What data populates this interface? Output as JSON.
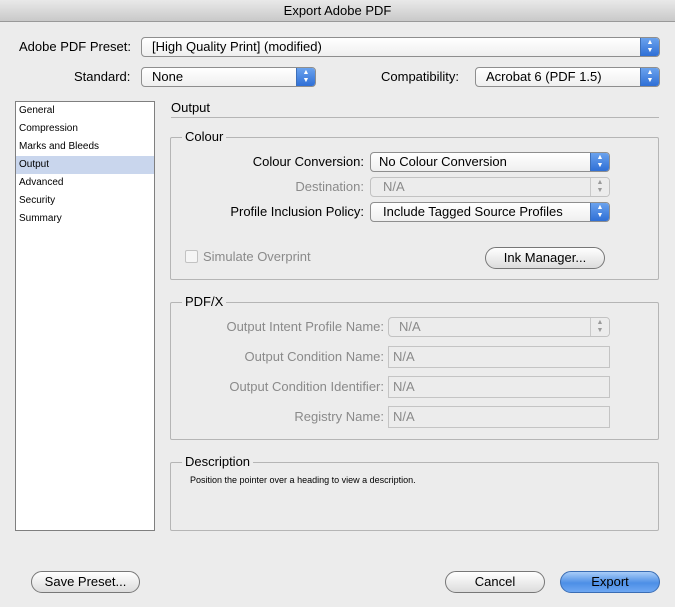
{
  "window": {
    "title": "Export Adobe PDF"
  },
  "top": {
    "preset_label": "Adobe PDF Preset:",
    "preset_value": "[High Quality Print] (modified)",
    "standard_label": "Standard:",
    "standard_value": "None",
    "compat_label": "Compatibility:",
    "compat_value": "Acrobat 6 (PDF 1.5)"
  },
  "sidebar": {
    "items": [
      {
        "label": "General"
      },
      {
        "label": "Compression"
      },
      {
        "label": "Marks and Bleeds"
      },
      {
        "label": "Output",
        "selected": true
      },
      {
        "label": "Advanced"
      },
      {
        "label": "Security"
      },
      {
        "label": "Summary"
      }
    ]
  },
  "panel": {
    "title": "Output"
  },
  "colour": {
    "title": "Colour",
    "conversion_label": "Colour Conversion:",
    "conversion_value": "No Colour Conversion",
    "destination_label": "Destination:",
    "destination_value": "N/A",
    "profile_label": "Profile Inclusion Policy:",
    "profile_value": "Include Tagged Source Profiles",
    "simulate_label": "Simulate Overprint",
    "ink_button": "Ink Manager..."
  },
  "pdfx": {
    "title": "PDF/X",
    "intent_label": "Output Intent Profile Name:",
    "intent_value": "N/A",
    "condition_label": "Output Condition Name:",
    "condition_value": "N/A",
    "identifier_label": "Output Condition Identifier:",
    "identifier_value": "N/A",
    "registry_label": "Registry Name:",
    "registry_value": "N/A"
  },
  "description": {
    "title": "Description",
    "text": "Position the pointer over a heading to view a description."
  },
  "buttons": {
    "save_preset": "Save Preset...",
    "cancel": "Cancel",
    "export": "Export"
  }
}
